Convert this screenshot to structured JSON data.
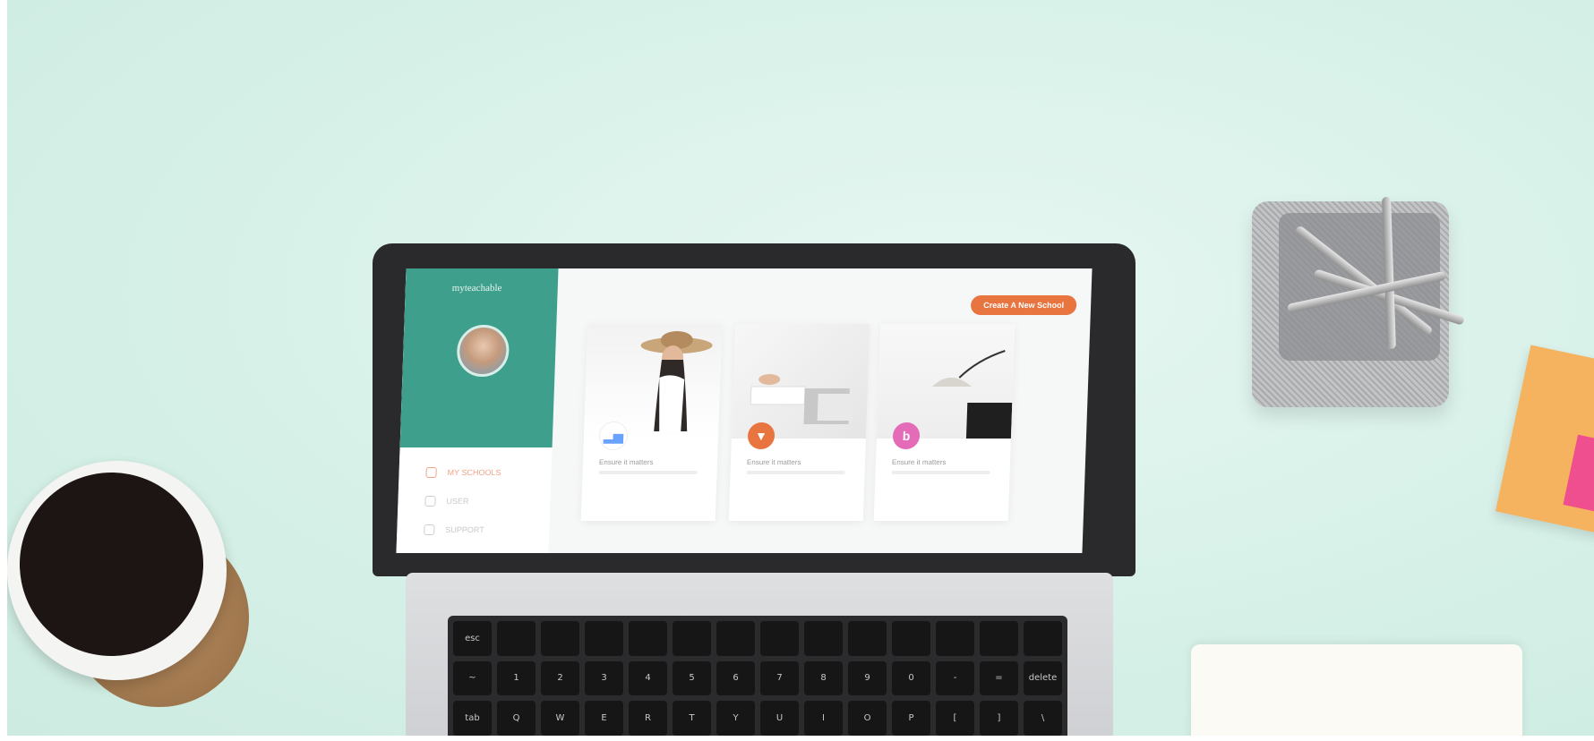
{
  "screen_ui": {
    "brand": "myteachable",
    "cta_button": "Create A New School",
    "menu_items": [
      {
        "label": "MY SCHOOLS",
        "active": true
      },
      {
        "label": "USER",
        "active": false
      },
      {
        "label": "SUPPORT",
        "active": false
      }
    ],
    "cards": [
      {
        "title": "Ensure it matters",
        "badge_color": "#6aa3ff",
        "badge_icon": "chart-icon"
      },
      {
        "title": "Ensure it matters",
        "badge_color": "#e8743f",
        "badge_icon": "triangle-down-icon"
      },
      {
        "title": "Ensure it matters",
        "badge_color": "#e36bb8",
        "badge_icon": "beats-icon"
      }
    ]
  },
  "keyboard_keys": [
    "esc",
    "",
    "",
    "",
    "",
    "",
    "",
    "",
    "",
    "",
    "",
    "",
    "",
    "",
    "~",
    "1",
    "2",
    "3",
    "4",
    "5",
    "6",
    "7",
    "8",
    "9",
    "0",
    "-",
    "=",
    "delete",
    "tab",
    "Q",
    "W",
    "E",
    "R",
    "T",
    "Y",
    "U",
    "I",
    "O",
    "P",
    "[",
    "]",
    "\\"
  ]
}
